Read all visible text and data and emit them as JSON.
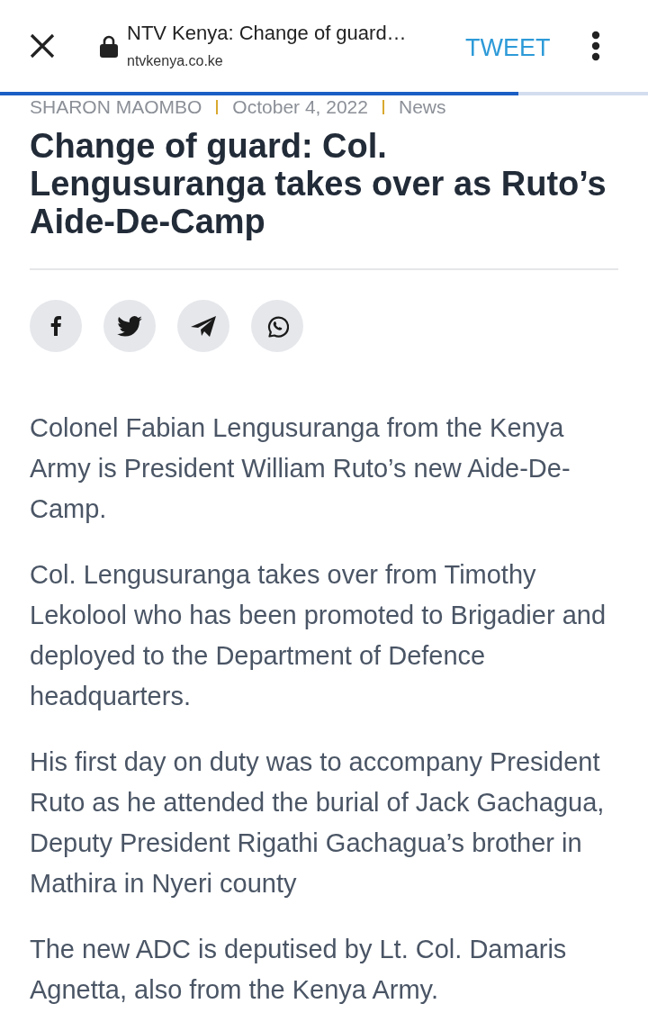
{
  "browser_bar": {
    "page_title": "NTV Kenya: Change of guard…",
    "url": "ntvkenya.co.ke",
    "action": "TWEET",
    "load_progress": {
      "level": 0.8
    }
  },
  "article": {
    "meta": [
      "SHARON MAOMBO",
      "October 4, 2022",
      "News"
    ],
    "title": "Change of guard: Col. Lengusuranga takes over as Ruto’s Aide-De-Camp",
    "share_buttons": [
      {
        "kind": "facebook"
      },
      {
        "kind": "twitter"
      },
      {
        "kind": "telegram"
      },
      {
        "kind": "whatsapp"
      }
    ],
    "paragraphs": [
      "Colonel Fabian Lengusuranga from the Kenya Army is President William Ruto’s new Aide-De-Camp.",
      "Col. Lengusuranga takes over from Timothy Lekolool who has been promoted to Brigadier and deployed to the Department of Defence headquarters.",
      "His first day on duty was to accompany President Ruto as he attended the burial of Jack Gachagua, Deputy President Rigathi Gachagua’s brother in Mathira in Nyeri county",
      "The new ADC is deputised by Lt. Col. Damaris Agnetta, also from the Kenya Army."
    ]
  }
}
